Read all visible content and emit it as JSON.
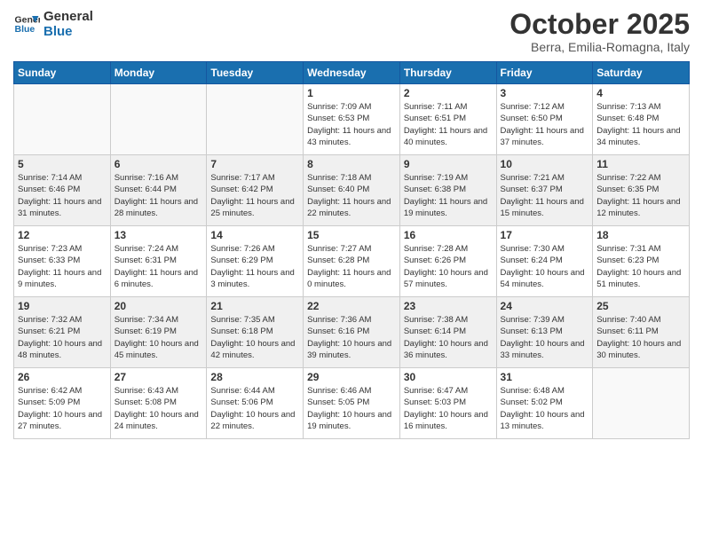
{
  "logo": {
    "line1": "General",
    "line2": "Blue"
  },
  "title": "October 2025",
  "subtitle": "Berra, Emilia-Romagna, Italy",
  "days_of_week": [
    "Sunday",
    "Monday",
    "Tuesday",
    "Wednesday",
    "Thursday",
    "Friday",
    "Saturday"
  ],
  "weeks": [
    [
      {
        "day": "",
        "info": ""
      },
      {
        "day": "",
        "info": ""
      },
      {
        "day": "",
        "info": ""
      },
      {
        "day": "1",
        "info": "Sunrise: 7:09 AM\nSunset: 6:53 PM\nDaylight: 11 hours and 43 minutes."
      },
      {
        "day": "2",
        "info": "Sunrise: 7:11 AM\nSunset: 6:51 PM\nDaylight: 11 hours and 40 minutes."
      },
      {
        "day": "3",
        "info": "Sunrise: 7:12 AM\nSunset: 6:50 PM\nDaylight: 11 hours and 37 minutes."
      },
      {
        "day": "4",
        "info": "Sunrise: 7:13 AM\nSunset: 6:48 PM\nDaylight: 11 hours and 34 minutes."
      }
    ],
    [
      {
        "day": "5",
        "info": "Sunrise: 7:14 AM\nSunset: 6:46 PM\nDaylight: 11 hours and 31 minutes."
      },
      {
        "day": "6",
        "info": "Sunrise: 7:16 AM\nSunset: 6:44 PM\nDaylight: 11 hours and 28 minutes."
      },
      {
        "day": "7",
        "info": "Sunrise: 7:17 AM\nSunset: 6:42 PM\nDaylight: 11 hours and 25 minutes."
      },
      {
        "day": "8",
        "info": "Sunrise: 7:18 AM\nSunset: 6:40 PM\nDaylight: 11 hours and 22 minutes."
      },
      {
        "day": "9",
        "info": "Sunrise: 7:19 AM\nSunset: 6:38 PM\nDaylight: 11 hours and 19 minutes."
      },
      {
        "day": "10",
        "info": "Sunrise: 7:21 AM\nSunset: 6:37 PM\nDaylight: 11 hours and 15 minutes."
      },
      {
        "day": "11",
        "info": "Sunrise: 7:22 AM\nSunset: 6:35 PM\nDaylight: 11 hours and 12 minutes."
      }
    ],
    [
      {
        "day": "12",
        "info": "Sunrise: 7:23 AM\nSunset: 6:33 PM\nDaylight: 11 hours and 9 minutes."
      },
      {
        "day": "13",
        "info": "Sunrise: 7:24 AM\nSunset: 6:31 PM\nDaylight: 11 hours and 6 minutes."
      },
      {
        "day": "14",
        "info": "Sunrise: 7:26 AM\nSunset: 6:29 PM\nDaylight: 11 hours and 3 minutes."
      },
      {
        "day": "15",
        "info": "Sunrise: 7:27 AM\nSunset: 6:28 PM\nDaylight: 11 hours and 0 minutes."
      },
      {
        "day": "16",
        "info": "Sunrise: 7:28 AM\nSunset: 6:26 PM\nDaylight: 10 hours and 57 minutes."
      },
      {
        "day": "17",
        "info": "Sunrise: 7:30 AM\nSunset: 6:24 PM\nDaylight: 10 hours and 54 minutes."
      },
      {
        "day": "18",
        "info": "Sunrise: 7:31 AM\nSunset: 6:23 PM\nDaylight: 10 hours and 51 minutes."
      }
    ],
    [
      {
        "day": "19",
        "info": "Sunrise: 7:32 AM\nSunset: 6:21 PM\nDaylight: 10 hours and 48 minutes."
      },
      {
        "day": "20",
        "info": "Sunrise: 7:34 AM\nSunset: 6:19 PM\nDaylight: 10 hours and 45 minutes."
      },
      {
        "day": "21",
        "info": "Sunrise: 7:35 AM\nSunset: 6:18 PM\nDaylight: 10 hours and 42 minutes."
      },
      {
        "day": "22",
        "info": "Sunrise: 7:36 AM\nSunset: 6:16 PM\nDaylight: 10 hours and 39 minutes."
      },
      {
        "day": "23",
        "info": "Sunrise: 7:38 AM\nSunset: 6:14 PM\nDaylight: 10 hours and 36 minutes."
      },
      {
        "day": "24",
        "info": "Sunrise: 7:39 AM\nSunset: 6:13 PM\nDaylight: 10 hours and 33 minutes."
      },
      {
        "day": "25",
        "info": "Sunrise: 7:40 AM\nSunset: 6:11 PM\nDaylight: 10 hours and 30 minutes."
      }
    ],
    [
      {
        "day": "26",
        "info": "Sunrise: 6:42 AM\nSunset: 5:09 PM\nDaylight: 10 hours and 27 minutes."
      },
      {
        "day": "27",
        "info": "Sunrise: 6:43 AM\nSunset: 5:08 PM\nDaylight: 10 hours and 24 minutes."
      },
      {
        "day": "28",
        "info": "Sunrise: 6:44 AM\nSunset: 5:06 PM\nDaylight: 10 hours and 22 minutes."
      },
      {
        "day": "29",
        "info": "Sunrise: 6:46 AM\nSunset: 5:05 PM\nDaylight: 10 hours and 19 minutes."
      },
      {
        "day": "30",
        "info": "Sunrise: 6:47 AM\nSunset: 5:03 PM\nDaylight: 10 hours and 16 minutes."
      },
      {
        "day": "31",
        "info": "Sunrise: 6:48 AM\nSunset: 5:02 PM\nDaylight: 10 hours and 13 minutes."
      },
      {
        "day": "",
        "info": ""
      }
    ]
  ]
}
